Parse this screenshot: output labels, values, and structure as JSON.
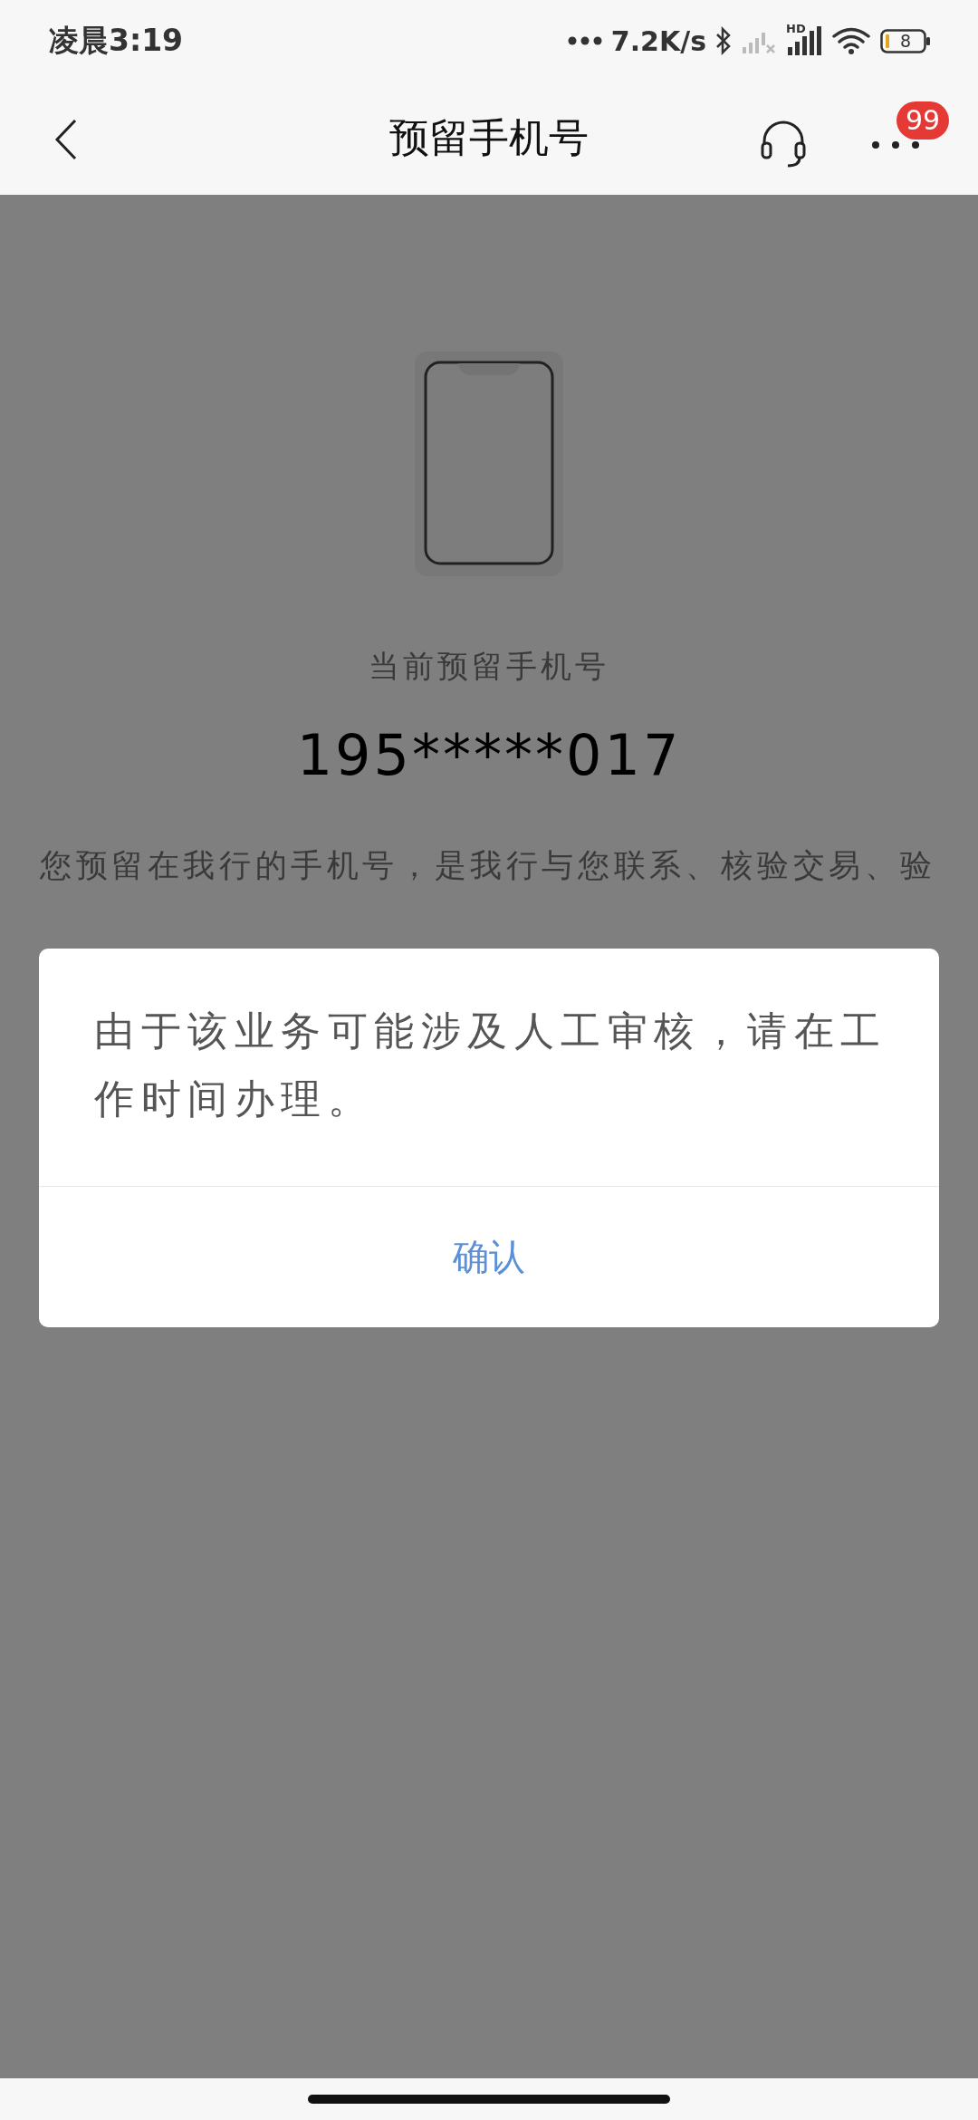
{
  "status_bar": {
    "time": "凌晨3:19",
    "net_speed": "7.2K/s",
    "signal_label": "HD",
    "battery": "8"
  },
  "header": {
    "title": "预留手机号",
    "badge": "99"
  },
  "phone": {
    "label": "当前预留手机号",
    "number": "195*****017",
    "notice": "您预留在我行的手机号，是我行与您联系、核验交易、验"
  },
  "dialog": {
    "message": "由于该业务可能涉及人工审核，请在工作时间办理。",
    "buttons": [
      "确认"
    ]
  }
}
